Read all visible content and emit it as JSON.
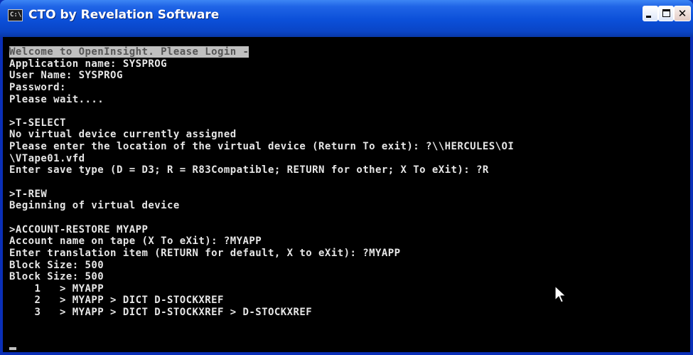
{
  "window": {
    "title": "CTO by Revelation Software",
    "icon_text": "C:\\",
    "controls": {
      "minimize_icon": "minimize-icon",
      "maximize_icon": "maximize-icon",
      "close_label": "✕"
    }
  },
  "console": {
    "lines": [
      "Welcome to OpenInsight. Please Login -",
      "Application name: SYSPROG",
      "User Name: SYSPROG",
      "Password:",
      "Please wait....",
      "",
      ">T-SELECT",
      "No virtual device currently assigned",
      "Please enter the location of the virtual device (Return To exit): ?\\\\HERCULES\\OI",
      "\\VTape01.vfd",
      "Enter save type (D = D3; R = R83Compatible; RETURN for other; X To eXit): ?R",
      "",
      ">T-REW",
      "Beginning of virtual device",
      "",
      ">ACCOUNT-RESTORE MYAPP",
      "Account name on tape (X To eXit): ?MYAPP",
      "Enter translation item (RETURN for default, X to eXit): ?MYAPP",
      "Block Size: 500",
      "Block Size: 500",
      "    1   > MYAPP",
      "    2   > MYAPP > DICT D-STOCKXREF",
      "    3   > MYAPP > DICT D-STOCKXREF > D-STOCKXREF"
    ],
    "highlighted_line_index": 0
  },
  "colors": {
    "titlebar": "#0b4fd8",
    "console_bg": "#000000",
    "console_text": "#e6e6e6",
    "highlight_bg": "#c0c0c0"
  }
}
